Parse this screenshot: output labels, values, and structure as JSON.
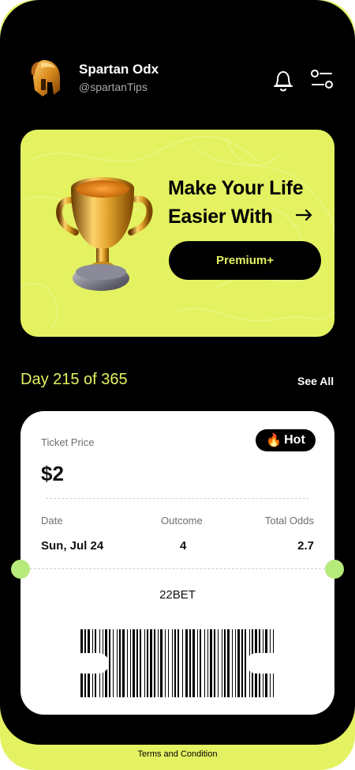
{
  "profile": {
    "name": "Spartan Odx",
    "handle": "@spartanTips",
    "avatar_icon": "spartan-helmet-icon"
  },
  "header_icons": [
    "bell-icon",
    "filter-sliders-icon"
  ],
  "banner": {
    "title": "Make Your Life Easier With",
    "arrow_icon": "arrow-right-icon",
    "button_label": "Premium+",
    "image": "golden-trophy-icon"
  },
  "progress": {
    "label": "Day 215 of 365",
    "current_day": 215,
    "total_days": 365,
    "see_all_label": "See All"
  },
  "ticket": {
    "price_label": "Ticket Price",
    "price": "$2",
    "badge": {
      "emoji": "🔥",
      "label": "Hot"
    },
    "columns": [
      {
        "label": "Date",
        "value": "Sun, Jul 24"
      },
      {
        "label": "Outcome",
        "value": "4"
      },
      {
        "label": "Total Odds",
        "value": "2.7"
      }
    ],
    "bookmaker": "22BET",
    "barcode_icon": "barcode-icon"
  },
  "footer": {
    "link_label": "Terms and Condition"
  },
  "colors": {
    "accent": "#e4f262",
    "background": "#000000",
    "card": "#ffffff",
    "notch": "#b6ea7b"
  }
}
